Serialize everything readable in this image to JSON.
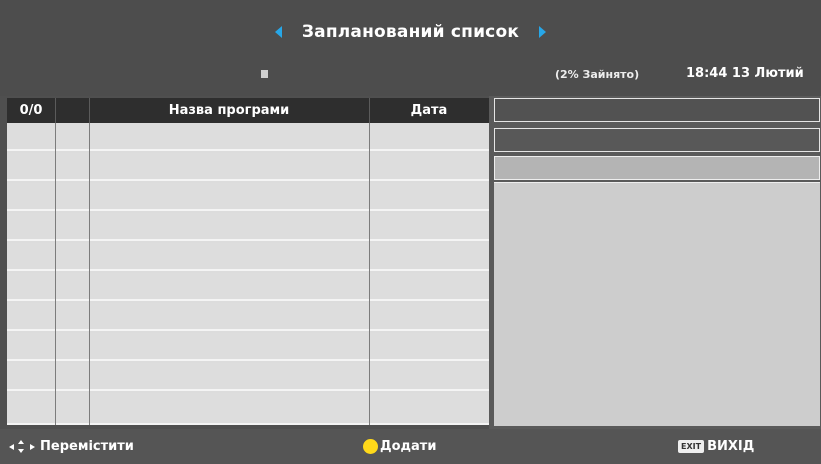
{
  "header": {
    "title": "Запланований список",
    "usage": "(2% Зайнято)",
    "clock": "18:44 13 Лютий"
  },
  "table": {
    "columns": {
      "count": "0/0",
      "mark": "",
      "name": "Назва програми",
      "date": "Дата"
    },
    "rows": [],
    "empty_row_count": 10
  },
  "footer": {
    "move_label": "Перемістити",
    "add_label": "Додати",
    "exit_key": "EXIT",
    "exit_label": "ВИХІД"
  },
  "colors": {
    "accent": "#27a7e8",
    "yellow_key": "#ffd91a",
    "header_bg": "#4d4d4d",
    "row_bg": "#dddddd"
  },
  "icons": [
    "left-arrow-icon",
    "right-arrow-icon",
    "navigation-arrows-icon",
    "yellow-button-icon",
    "exit-key-icon",
    "status-square-icon"
  ]
}
